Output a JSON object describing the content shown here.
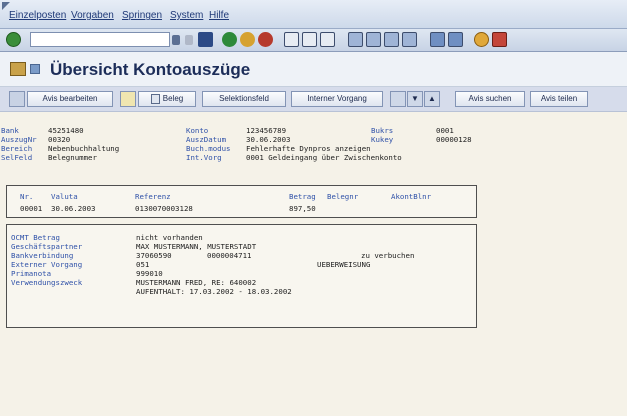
{
  "menu": [
    "Einzelposten",
    "Vorgaben",
    "Springen",
    "System",
    "Hilfe"
  ],
  "title": "Übersicht Kontoauszüge",
  "toolbar": {
    "anzeigen": "Avis bearbeiten",
    "beleg": "Beleg",
    "selektionsfeld": "Selektionsfeld",
    "interner_vorgang": "Interner Vorgang",
    "avis_suchen": "Avis suchen",
    "avis_teilen": "Avis teilen"
  },
  "header": {
    "bank_label": "Bank",
    "bank_value": "45251480",
    "auszugnr_label": "AuszugNr",
    "auszugnr_value": "00320",
    "bereich_label": "Bereich",
    "bereich_value": "Nebenbuchhaltung",
    "selfeld_label": "SelFeld",
    "selfeld_value": "Belegnummer",
    "konto_label": "Konto",
    "konto_value": "123456789",
    "auszdatum_label": "AuszDatum",
    "auszdatum_value": "30.06.2003",
    "buchmodus_label": "Buch.modus",
    "buchmodus_value": "Fehlerhafte Dynpros anzeigen",
    "intvorg_label": "Int.Vorg",
    "intvorg_value": "0001 Geldeingang über Zwischenkonto",
    "bukrs_label": "Bukrs",
    "bukrs_value": "0001",
    "kukey_label": "Kukey",
    "kukey_value": "00000128"
  },
  "items": {
    "headers": {
      "nr": "Nr.",
      "valuta": "Valuta",
      "referenz": "Referenz",
      "betrag": "Betrag",
      "belegnr": "Belegnr",
      "akontblnr": "AkontBlnr"
    },
    "row": {
      "nr": "00001",
      "valuta": "30.06.2003",
      "referenz": "0130070003128",
      "betrag": "897,50"
    }
  },
  "details": {
    "ocmt_label": "OCMT Betrag",
    "ocmt_value": "nicht vorhanden",
    "partner_label": "Geschäftspartner",
    "partner_value": "MAX MUSTERMANN, MUSTERSTADT",
    "bank_label": "Bankverbindung",
    "bank_blz": "37060590",
    "bank_konto": "0000004711",
    "bank_note": "zu verbuchen",
    "extern_label": "Externer Vorgang",
    "extern_code": "051",
    "extern_text": "UEBERWEISUNG",
    "prima_label": "Primanota",
    "prima_value": "999010",
    "zweck_label": "Verwendungszweck",
    "zweck_line1": "MUSTERMANN FRED, RE: 640002",
    "zweck_line2": "AUFENTHALT: 17.03.2002 - 18.03.2002"
  },
  "colors": {
    "label": "#2f51a8",
    "title": "#1c2d59",
    "menu": "#203a78"
  }
}
